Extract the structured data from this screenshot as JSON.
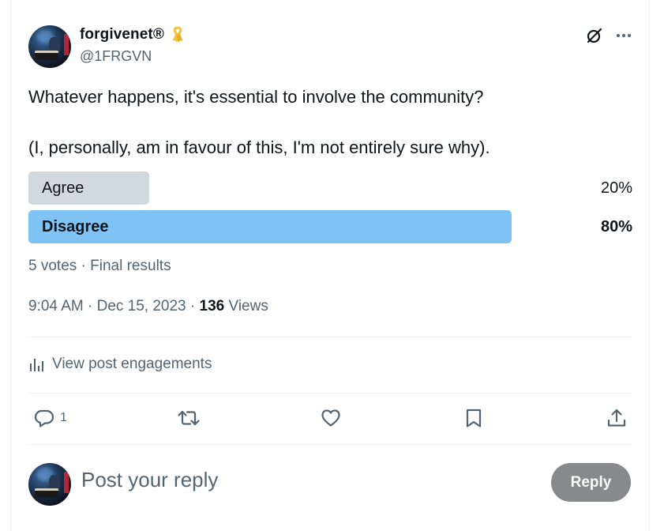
{
  "post": {
    "author": {
      "display_name": "forgivenet®",
      "handle": "@1FRGVN"
    },
    "text_line_1": "Whatever happens, it's essential to involve the community?",
    "text_line_2": "(I, personally, am in favour of this, I'm not entirely sure why).",
    "poll": {
      "options": [
        {
          "label": "Agree",
          "percent_text": "20%",
          "percent": 20,
          "winner": false
        },
        {
          "label": "Disagree",
          "percent_text": "80%",
          "percent": 80,
          "winner": true
        }
      ],
      "meta": "5 votes · Final results"
    },
    "timestamp": "9:04 AM · Dec 15, 2023",
    "separator": " · ",
    "views_count": "136",
    "views_label": "Views",
    "engagements_label": "View post engagements",
    "actions": {
      "reply_count": "1"
    }
  },
  "reply_box": {
    "placeholder": "Post your reply",
    "button_label": "Reply"
  },
  "icons": {
    "ribbon": "ribbon-icon",
    "grok": "grok-icon",
    "more": "more-icon",
    "engagements": "bar-chart-icon",
    "reply": "reply-icon",
    "repost": "repost-icon",
    "like": "heart-icon",
    "bookmark": "bookmark-icon",
    "share": "share-icon"
  },
  "colors": {
    "poll_winner": "#7ec3f3",
    "poll_other": "#cfd9de",
    "muted_text": "#536471",
    "ribbon": "#f5c33b",
    "reply_button": "#87898c"
  }
}
